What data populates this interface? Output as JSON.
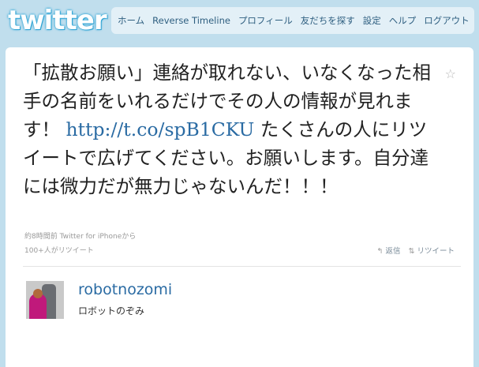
{
  "brand": {
    "logo_text": "twitter"
  },
  "nav": {
    "items": [
      "ホーム",
      "Reverse Timeline",
      "プロフィール",
      "友だちを探す",
      "設定",
      "ヘルプ",
      "ログアウト"
    ]
  },
  "tweet": {
    "text_before_link": "「拡散お願い」連絡が取れない、いなくなった相手の名前をいれるだけでその人の情報が見れます！ ",
    "link": "http://t.co/spB1CKU",
    "text_after_link": " たくさんの人にリツイートで広げてください。お願いします。自分達には微力だが無力じゃないんだ！！！",
    "time": "約8時間前",
    "via": "Twitter for iPhoneから",
    "retweet_count": "100+人がリツイート",
    "reply_label": "返信",
    "retweet_label": "リツイート",
    "star_icon": "star-icon"
  },
  "user": {
    "username": "robotnozomi",
    "display_name": "ロボットのぞみ"
  },
  "colors": {
    "background": "#c0deed",
    "link": "#2a6ba3"
  }
}
